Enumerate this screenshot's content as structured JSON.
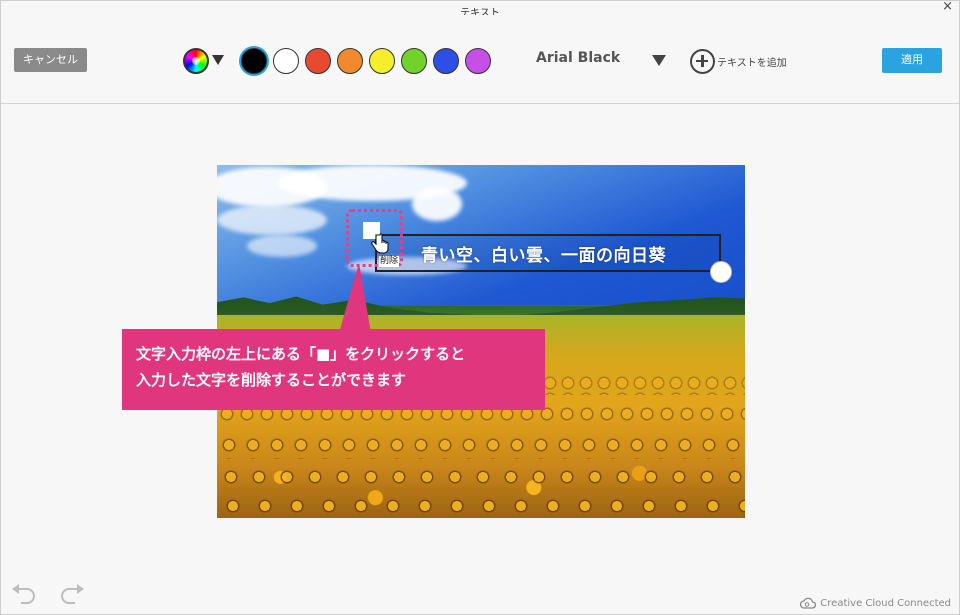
{
  "window": {
    "title": "テキスト"
  },
  "toolbar": {
    "cancel_label": "キャンセル",
    "apply_label": "適用",
    "font_name": "Arial Black",
    "add_text_label": "テキストを追加",
    "swatches": [
      {
        "name": "black",
        "color": "#000000",
        "selected": true
      },
      {
        "name": "white",
        "color": "#ffffff",
        "selected": false
      },
      {
        "name": "red",
        "color": "#e84a2f",
        "selected": false
      },
      {
        "name": "orange",
        "color": "#f08a2c",
        "selected": false
      },
      {
        "name": "yellow",
        "color": "#f6ee2a",
        "selected": false
      },
      {
        "name": "green",
        "color": "#71d22a",
        "selected": false
      },
      {
        "name": "blue",
        "color": "#2c4fe5",
        "selected": false
      },
      {
        "name": "purple",
        "color": "#c74ee6",
        "selected": false
      }
    ]
  },
  "canvas": {
    "text_content": "青い空、白い雲、一面の向日葵",
    "delete_tooltip": "削除"
  },
  "annotation": {
    "line1": "文字入力枠の左上にある「■」をクリックすると",
    "line2": "入力した文字を削除することができます",
    "accent_color": "#e0367d"
  },
  "footer": {
    "cc_status": "Creative Cloud Connected"
  }
}
